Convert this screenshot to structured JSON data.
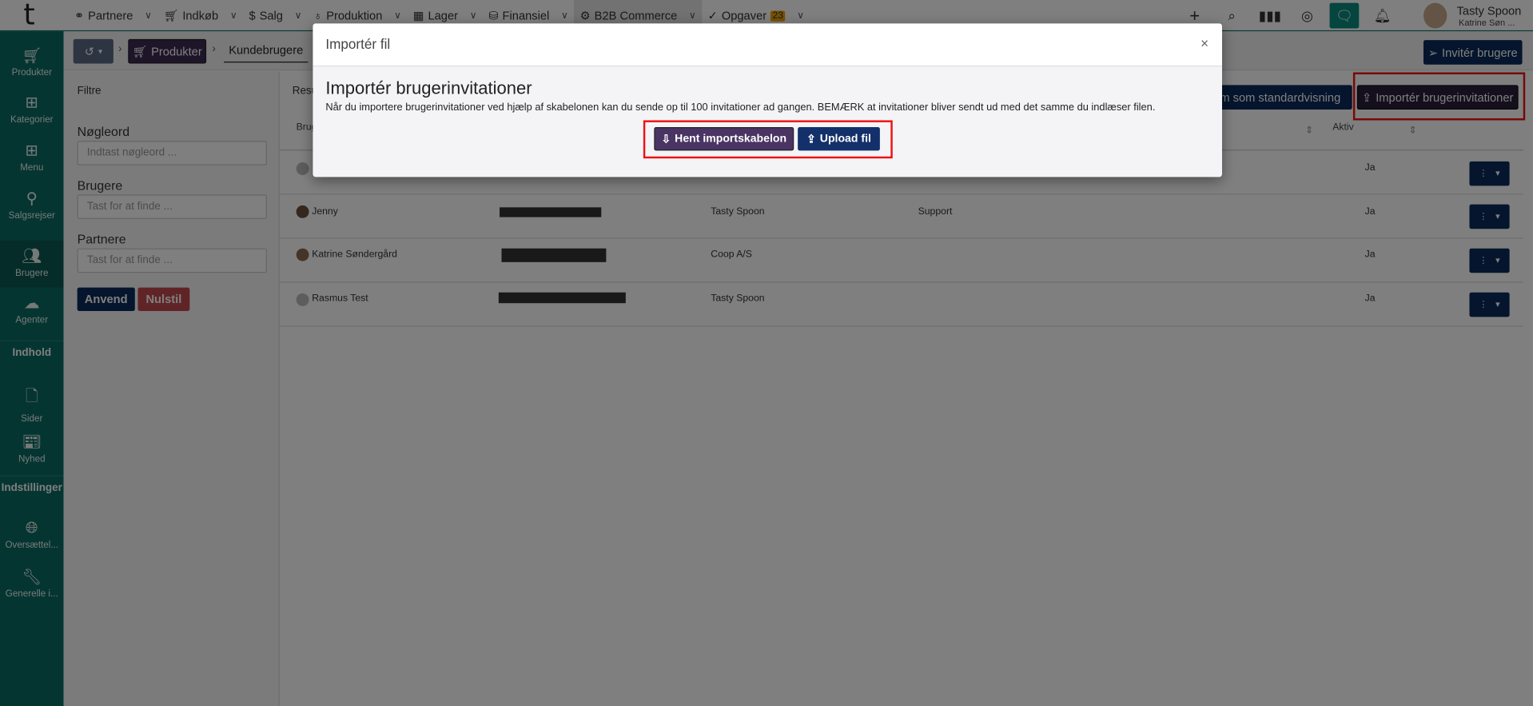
{
  "topbar": {
    "logo": "t",
    "nav": [
      {
        "label": "Partnere",
        "icon": "handshake-icon"
      },
      {
        "label": "Indkøb",
        "icon": "cart-icon"
      },
      {
        "label": "Salg",
        "icon": "money-hand-icon"
      },
      {
        "label": "Produktion",
        "icon": "pot-icon"
      },
      {
        "label": "Lager",
        "icon": "warehouse-icon"
      },
      {
        "label": "Finansiel",
        "icon": "coins-icon"
      },
      {
        "label": "B2B Commerce",
        "icon": "b2b-icon",
        "active": true
      },
      {
        "label": "Opgaver",
        "icon": "check-icon",
        "badge": "23"
      }
    ],
    "user": {
      "name": "Tasty Spoon",
      "sub": "Katrine Søn ..."
    }
  },
  "sidebar": {
    "items": [
      {
        "label": "Produkter",
        "icon": "cart-icon"
      },
      {
        "label": "Kategorier",
        "icon": "hierarchy-icon"
      },
      {
        "label": "Menu",
        "icon": "menu-tree-icon"
      },
      {
        "label": "Salgsrejser",
        "icon": "route-icon"
      },
      {
        "label": "Brugere",
        "icon": "users-icon",
        "active": true
      },
      {
        "label": "Agenter",
        "icon": "cloud-icon"
      },
      {
        "label": "Sider",
        "icon": "page-icon"
      },
      {
        "label": "Nyhed",
        "icon": "newspaper-icon"
      },
      {
        "label": "Oversættel...",
        "icon": "globe-icon"
      },
      {
        "label": "Generelle i...",
        "icon": "wrench-icon"
      }
    ],
    "sections": [
      "Indhold",
      "Indstillinger"
    ]
  },
  "breadcrumb": {
    "products": "Produkter",
    "current": "Kundebrugere"
  },
  "invite_button": "Invitér brugere",
  "filters": {
    "title": "Filtre",
    "keyword_label": "Nøgleord",
    "keyword_placeholder": "Indtast nøgleord ...",
    "users_label": "Brugere",
    "users_placeholder": "Tast for at finde ...",
    "partners_label": "Partnere",
    "partners_placeholder": "Tast for at finde ...",
    "apply": "Anvend",
    "reset": "Nulstil"
  },
  "main": {
    "results_label": "Resu",
    "save_default": "Gem som standardvisning",
    "import_button": "Importér brugerinvitationer",
    "columns": {
      "user": "Brug",
      "active": "Aktiv"
    },
    "rows": [
      {
        "name": "",
        "company": "",
        "role": "",
        "active": "Ja"
      },
      {
        "name": "Jenny",
        "company": "Tasty Spoon",
        "role": "Support",
        "active": "Ja"
      },
      {
        "name": "Katrine Søndergård",
        "company": "Coop A/S",
        "role": "",
        "active": "Ja"
      },
      {
        "name": "Rasmus Test",
        "company": "Tasty Spoon",
        "role": "",
        "active": "Ja"
      }
    ]
  },
  "modal": {
    "title": "Importér fil",
    "close": "×",
    "heading": "Importér brugerinvitationer",
    "text": "Når du importere brugerinvitationer ved hjælp af skabelonen kan du sende op til 100 invitationer ad gangen. BEMÆRK at invitationer bliver sendt ud med det samme du indlæser filen.",
    "download_template": "Hent importskabelon",
    "upload": "Upload fil"
  },
  "colors": {
    "teal": "#0b6b62",
    "navy": "#0b2a5a",
    "purple": "#4a3463",
    "highlight": "#ee1111"
  }
}
